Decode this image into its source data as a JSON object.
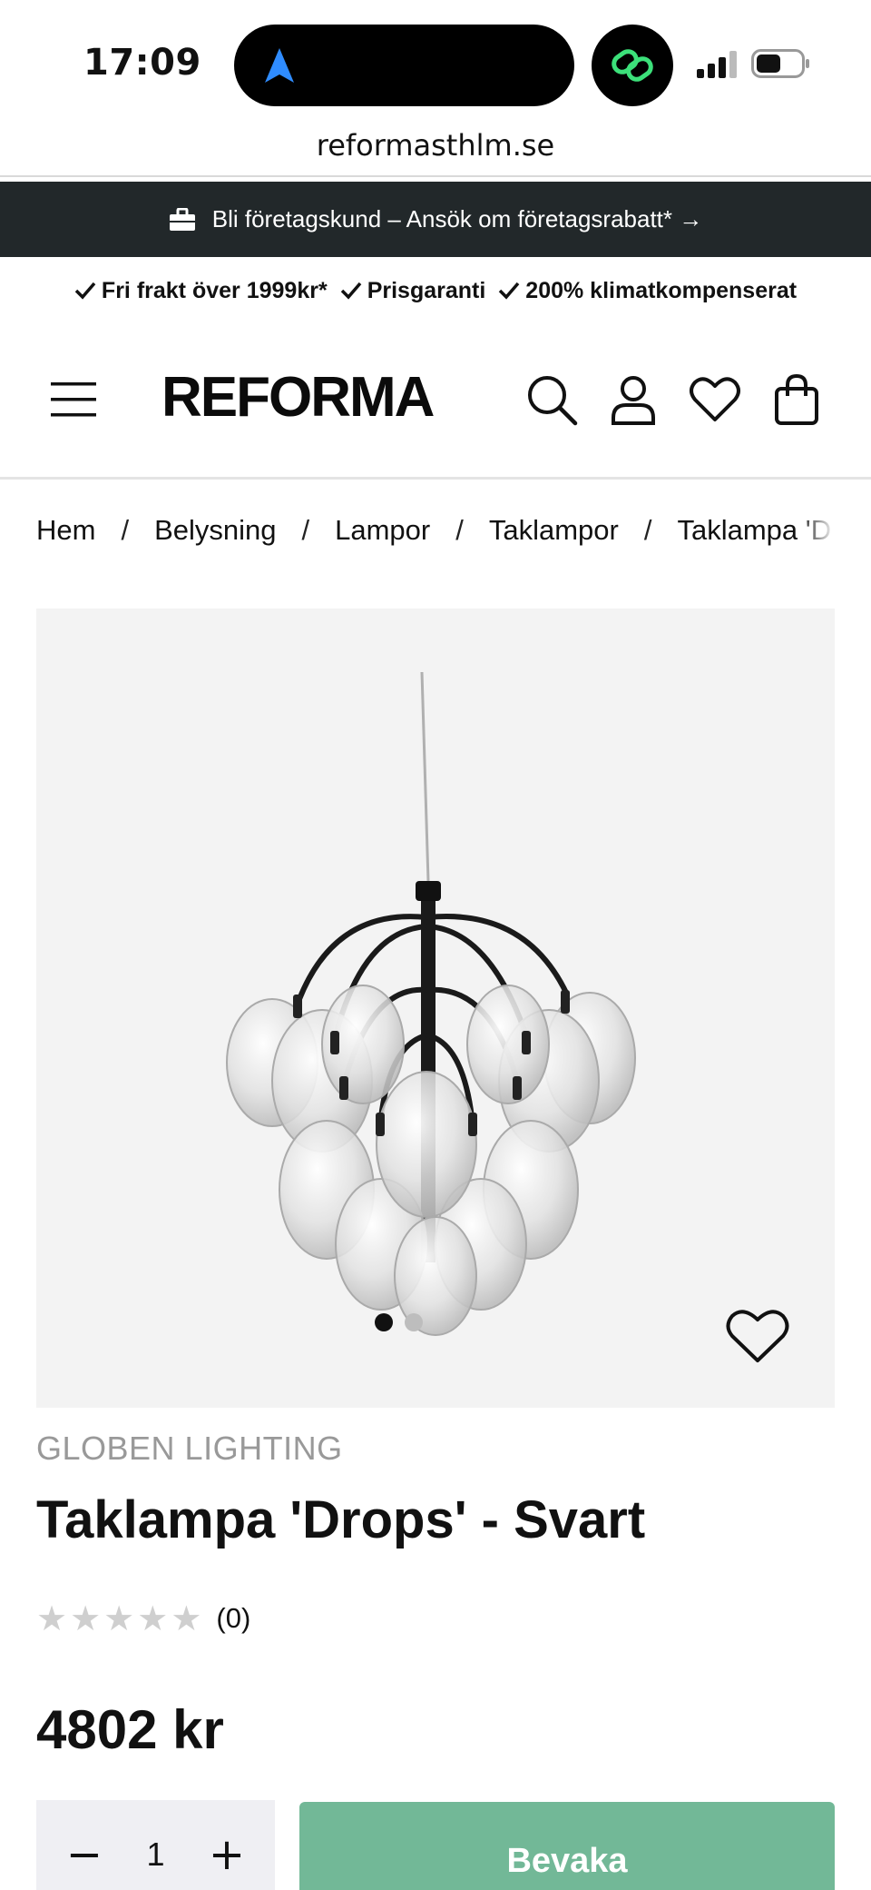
{
  "status_bar": {
    "time": "17:09",
    "url": "reformasthlm.se"
  },
  "promo_banner": {
    "text": "Bli företagskund – Ansök om företagsrabatt* →"
  },
  "usps": [
    {
      "label": "Fri frakt över 1999kr*"
    },
    {
      "label": "Prisgaranti"
    },
    {
      "label": "200% klimatkompenserat"
    }
  ],
  "header": {
    "logo": "REFORMA",
    "icons": [
      "menu-icon",
      "search-icon",
      "user-icon",
      "heart-icon",
      "shopping-bag-icon"
    ]
  },
  "breadcrumb": {
    "items": [
      "Hem",
      "Belysning",
      "Lampor",
      "Taklampor",
      "Taklampa 'Drops' - Svart"
    ],
    "separator": "/"
  },
  "gallery": {
    "slide_count": 2,
    "active_slide": 1
  },
  "product": {
    "brand": "GLOBEN LIGHTING",
    "title": "Taklampa 'Drops' - Svart",
    "rating_stars": 0,
    "rating_max": 5,
    "rating_count": "(0)",
    "price": "4802 kr"
  },
  "purchase": {
    "quantity": "1",
    "minus": "−",
    "plus": "+",
    "watch_label": "Bevaka"
  },
  "colors": {
    "banner_bg": "#22282a",
    "image_bg": "#f3f3f3",
    "button_green": "#72b897",
    "qty_bg": "#efeff3",
    "brand_gray": "#999999"
  }
}
